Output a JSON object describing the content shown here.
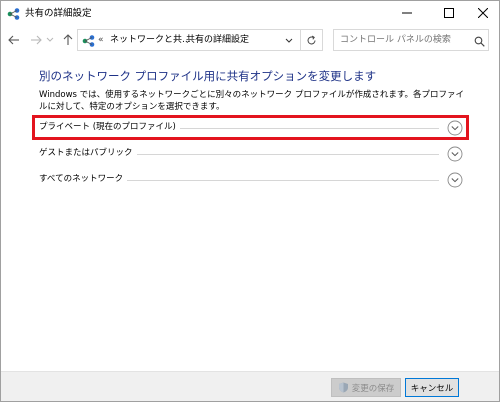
{
  "window": {
    "title": "共有の詳細設定",
    "title_icon": "network-sharing-icon",
    "controls": {
      "minimize": "minimize-icon",
      "maximize": "maximize-icon",
      "close": "close-icon"
    }
  },
  "nav": {
    "back": "back-arrow-icon",
    "forward": "forward-arrow-icon",
    "history": "chevron-down-icon",
    "up": "up-arrow-icon"
  },
  "address": {
    "overflow": "«",
    "crumb1": "ネットワークと共...",
    "separator": "›",
    "crumb2": "共有の詳細設定"
  },
  "search": {
    "placeholder": "コントロール パネルの検索"
  },
  "main": {
    "heading": "別のネットワーク プロファイル用に共有オプションを変更します",
    "description": "Windows では、使用するネットワークごとに別々のネットワーク プロファイルが作成されます。各プロファイルに対して、特定のオプションを選択できます。",
    "sections": [
      {
        "label": "プライベート (現在のプロファイル)",
        "highlighted": true
      },
      {
        "label": "ゲストまたはパブリック",
        "highlighted": false
      },
      {
        "label": "すべてのネットワーク",
        "highlighted": false
      }
    ]
  },
  "footer": {
    "save_label": "変更の保存",
    "cancel_label": "キャンセル"
  },
  "colors": {
    "heading": "#1e3287",
    "highlight": "#e3141e",
    "accent": "#0078d7"
  }
}
